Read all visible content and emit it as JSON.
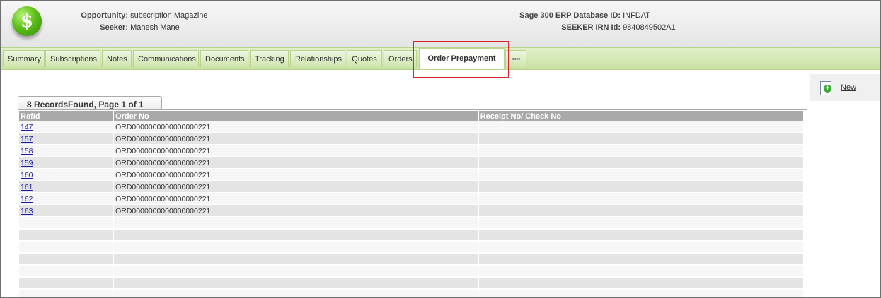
{
  "header": {
    "opportunity_label": "Opportunity:",
    "opportunity_value": "subscription Magazine",
    "seeker_label": "Seeker:",
    "seeker_value": "Mahesh Mane",
    "db_label": "Sage 300 ERP Database ID:",
    "db_value": "INFDAT",
    "irn_label": "SEEKER IRN Id:",
    "irn_value": "9840849502A1"
  },
  "tabs": [
    {
      "label": "Summary"
    },
    {
      "label": "Subscriptions"
    },
    {
      "label": "Notes"
    },
    {
      "label": "Communications"
    },
    {
      "label": "Documents"
    },
    {
      "label": "Tracking"
    },
    {
      "label": "Relationships"
    },
    {
      "label": "Quotes"
    },
    {
      "label": "Orders"
    },
    {
      "label": "Order Prepayment",
      "active": true
    },
    {
      "label": "••••"
    }
  ],
  "toolbar": {
    "new_label": "New"
  },
  "grid": {
    "records_label": "8 RecordsFound, Page 1 of 1",
    "columns": [
      "RefId",
      "Order No",
      "Receipt No/ Check No"
    ],
    "rows": [
      {
        "refid": "147",
        "order_no": "ORD0000000000000000221",
        "receipt": ""
      },
      {
        "refid": "157",
        "order_no": "ORD0000000000000000221",
        "receipt": ""
      },
      {
        "refid": "158",
        "order_no": "ORD0000000000000000221",
        "receipt": ""
      },
      {
        "refid": "159",
        "order_no": "ORD0000000000000000221",
        "receipt": ""
      },
      {
        "refid": "160",
        "order_no": "ORD0000000000000000221",
        "receipt": ""
      },
      {
        "refid": "161",
        "order_no": "ORD0000000000000000221",
        "receipt": ""
      },
      {
        "refid": "162",
        "order_no": "ORD0000000000000000221",
        "receipt": ""
      },
      {
        "refid": "163",
        "order_no": "ORD0000000000000000221",
        "receipt": ""
      }
    ]
  },
  "colors": {
    "highlight": "#d9262a",
    "tabbar": "#c8e2a2",
    "header_row": "#a9a9a9",
    "link": "#1a1aa6"
  }
}
